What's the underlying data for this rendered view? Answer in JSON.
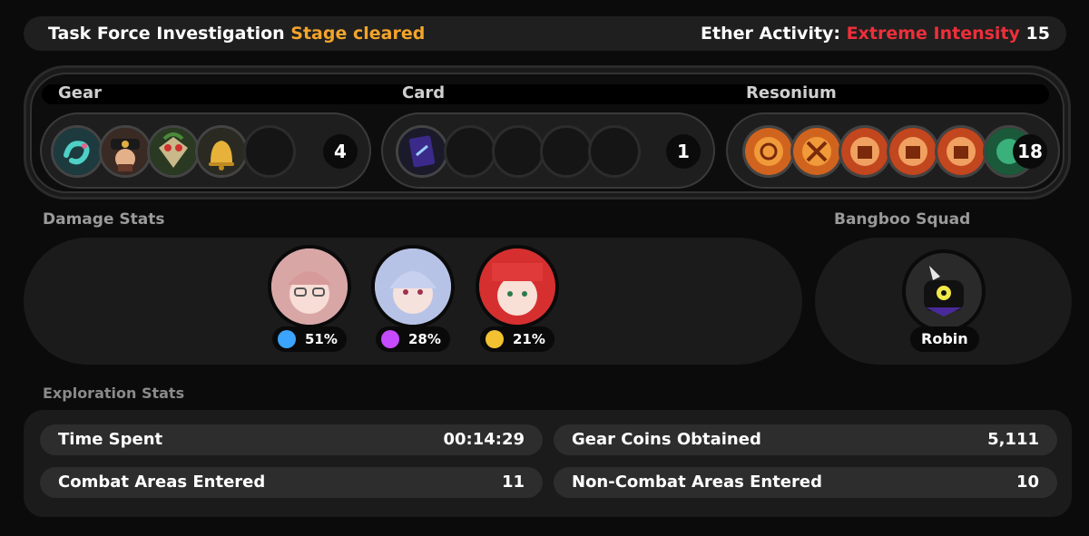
{
  "header": {
    "title": "Task Force Investigation",
    "status": "Stage cleared",
    "ether_label": "Ether Activity:",
    "ether_level": "Extreme Intensity",
    "ether_value": "15"
  },
  "loot": {
    "gear": {
      "label": "Gear",
      "count": "4",
      "icons": [
        "gear-serpent-icon",
        "gear-officer-icon",
        "gear-bird-icon",
        "gear-bell-icon"
      ]
    },
    "card": {
      "label": "Card",
      "count": "1",
      "icons": [
        "card-icon"
      ]
    },
    "resonium": {
      "label": "Resonium",
      "count": "18",
      "icons": [
        "resonium-clock-icon",
        "resonium-wrench-icon",
        "resonium-bomb-icon",
        "resonium-bomb-icon",
        "resonium-bomb-icon"
      ]
    }
  },
  "damage": {
    "label": "Damage Stats",
    "agents": [
      {
        "name": "agent-pink-hair-glasses",
        "percent": "51%",
        "element": "electric-icon",
        "color": "#3ba4ff"
      },
      {
        "name": "agent-silver-hair",
        "percent": "28%",
        "element": "ether-icon",
        "color": "#c64bff"
      },
      {
        "name": "agent-red-hair",
        "percent": "21%",
        "element": "physical-icon",
        "color": "#f2c230"
      }
    ]
  },
  "bangboo": {
    "label": "Bangboo Squad",
    "name": "Robin"
  },
  "exploration": {
    "label": "Exploration Stats",
    "rows": [
      {
        "label": "Time Spent",
        "value": "00:14:29"
      },
      {
        "label": "Gear Coins Obtained",
        "value": "5,111"
      },
      {
        "label": "Combat Areas Entered",
        "value": "11"
      },
      {
        "label": "Non-Combat Areas Entered",
        "value": "10"
      }
    ]
  },
  "colors": {
    "accent_orange": "#f3a42a",
    "accent_red": "#ee2f3a",
    "panel": "#1b1b1b",
    "row": "#2d2d2d"
  }
}
